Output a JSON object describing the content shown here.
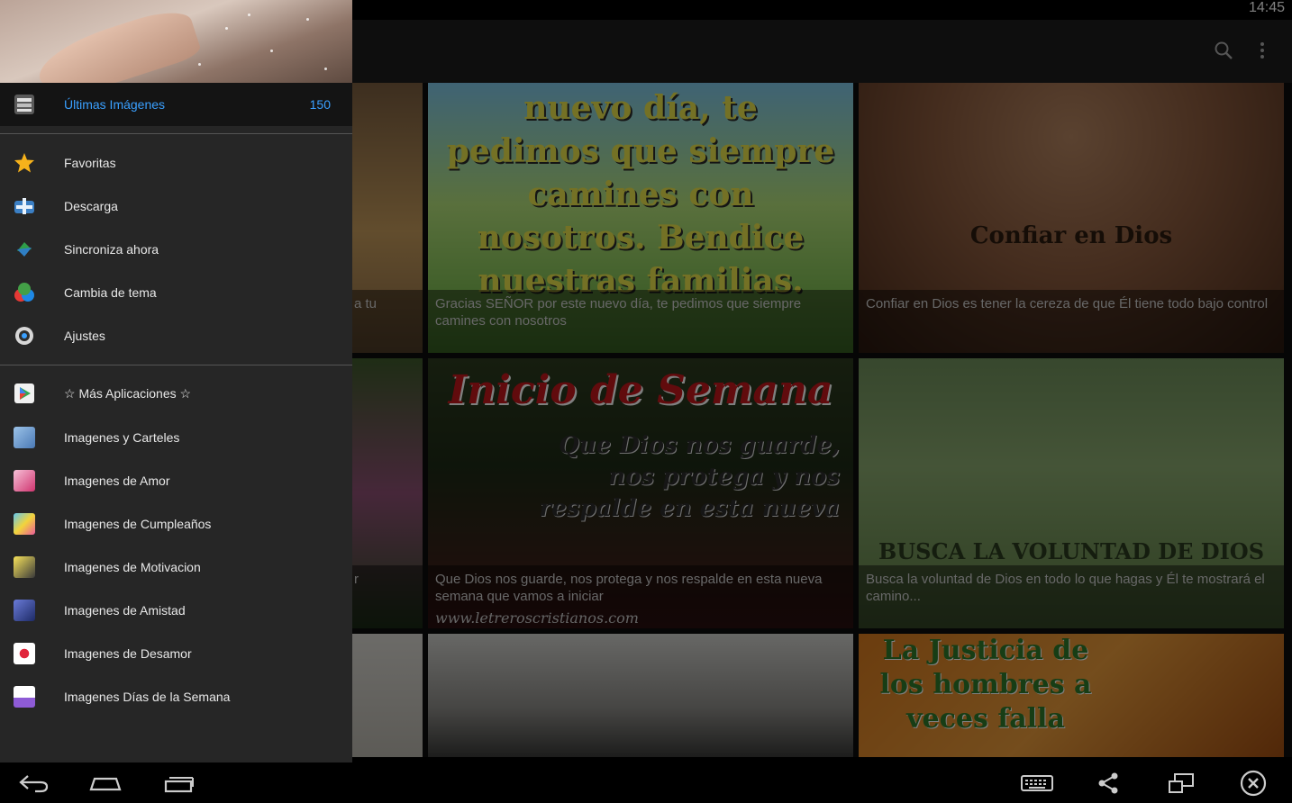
{
  "status_bar": {
    "time": "14:45"
  },
  "action_bar": {
    "icons": [
      "search-icon",
      "overflow-menu-icon"
    ]
  },
  "drawer": {
    "top_item": {
      "label": "Últimas Imágenes",
      "count": "150",
      "icon": "latest-images-icon"
    },
    "section1": [
      {
        "label": "Favoritas",
        "icon": "star-icon"
      },
      {
        "label": "Descarga",
        "icon": "download-icon"
      },
      {
        "label": "Sincroniza ahora",
        "icon": "sync-icon"
      },
      {
        "label": "Cambia de tema",
        "icon": "theme-icon"
      },
      {
        "label": "Ajustes",
        "icon": "settings-icon"
      }
    ],
    "section2": [
      {
        "label": "☆ Más Aplicaciones ☆",
        "icon": "play-store-icon"
      },
      {
        "label": "Imagenes y Carteles",
        "icon": "app-icon"
      },
      {
        "label": "Imagenes de Amor",
        "icon": "app-icon"
      },
      {
        "label": "Imagenes de Cumpleaños",
        "icon": "app-icon"
      },
      {
        "label": "Imagenes de Motivacion",
        "icon": "app-icon"
      },
      {
        "label": "Imagenes de Amistad",
        "icon": "app-icon"
      },
      {
        "label": "Imagenes de Desamor",
        "icon": "app-icon"
      },
      {
        "label": "Imagenes Días de la Semana",
        "icon": "app-icon"
      }
    ]
  },
  "grid": {
    "tiles": [
      {
        "caption": "Gracias SEÑOR por este nuevo día, te pedimos que siempre camines con nosotros",
        "image_text": "nuevo día, te pedimos que siempre camines con nosotros. Bendice nuestras familias."
      },
      {
        "caption": "Confiar en Dios es tener la cereza de que Él tiene todo bajo control",
        "image_text": "Confiar en Dios"
      },
      {
        "caption": "Que Dios nos guarde, nos protega y nos respalde en esta nueva semana que vamos a iniciar",
        "image_text": "Inicio de Semana",
        "image_subtext": "Que Dios nos guarde, nos protega y nos respalde en esta nueva",
        "image_url_text": "www.letreroscristianos.com"
      },
      {
        "caption": "Busca la voluntad de Dios en todo lo que hagas y Él te mostrará el camino...",
        "image_text": "BUSCA LA VOLUNTAD DE DIOS"
      },
      {
        "image_text": "La Justicia de los hombres a veces falla"
      }
    ],
    "partial_captions": [
      "a tu",
      "r"
    ]
  },
  "nav_bar": {
    "icons": [
      "back-icon",
      "home-icon",
      "recent-apps-icon",
      "keyboard-icon",
      "share-icon",
      "screen-rotate-icon",
      "close-icon"
    ]
  }
}
